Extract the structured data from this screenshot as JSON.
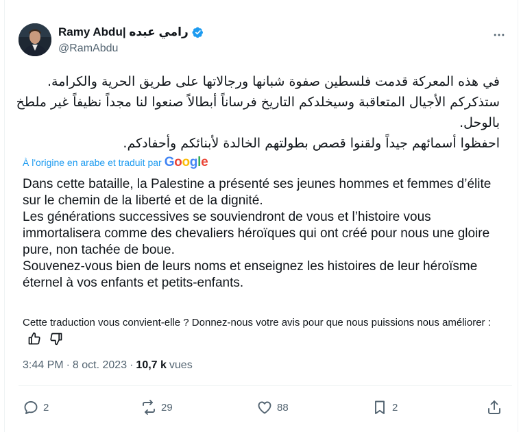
{
  "author": {
    "display_name": "Ramy Abdu| رامي عبده",
    "handle": "@RamAbdu",
    "verified": true
  },
  "icons": {
    "more": "more-dots-icon",
    "verified": "verified-badge-icon",
    "reply": "reply-icon",
    "repost": "repost-icon",
    "like": "heart-icon",
    "bookmark": "bookmark-icon",
    "share": "share-icon",
    "thumb_up": "thumbs-up-icon",
    "thumb_down": "thumbs-down-icon"
  },
  "colors": {
    "accent": "#1d9bf0",
    "secondary_text": "#536471",
    "primary_text": "#0f1419"
  },
  "tweet": {
    "original_text": "في هذه المعركة قدمت فلسطين صفوة شبانها ورجالاتها على طريق الحرية والكرامة.\nستذكركم الأجيال المتعاقبة وسيخلدكم التاريخ فرساناً أبطالاً صنعوا لنا مجداً نظيفاً غير ملطخ بالوحل.\nاحفظوا أسمائهم جيداً ولقنوا قصص بطولتهم الخالدة لأبنائكم وأحفادكم.",
    "translated_by_label": "À l'origine en arabe et traduit par",
    "translator_logo_text": "Google",
    "translated_text": "Dans cette bataille, la Palestine a présenté ses jeunes hommes et femmes d’élite sur le chemin de la liberté et de la dignité.\nLes générations successives se souviendront de vous et l’histoire vous immortalisera comme des chevaliers héroïques qui ont créé pour nous une gloire pure, non tachée de boue.\nSouvenez-vous bien de leurs noms et enseignez les histoires de leur héroïsme éternel à vos enfants et petits-enfants.",
    "feedback_prompt": "Cette traduction vous convient-elle ? Donnez-nous votre avis pour que nous puissions nous améliorer :",
    "time": "3:44 PM",
    "separator": "·",
    "date": "8 oct. 2023",
    "views_count": "10,7 k",
    "views_label": "vues"
  },
  "actions": {
    "replies": "2",
    "reposts": "29",
    "likes": "88",
    "bookmarks": "2"
  }
}
